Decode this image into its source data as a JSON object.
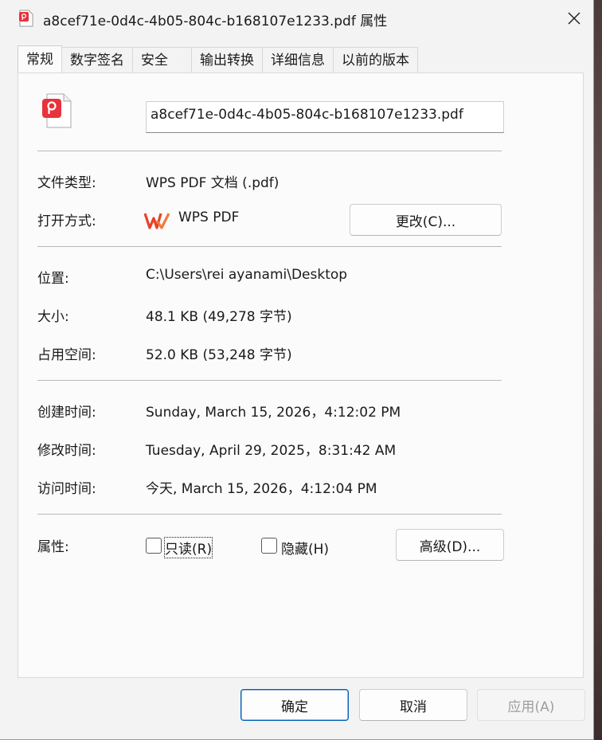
{
  "window": {
    "title": "a8cef71e-0d4c-4b05-804c-b168107e1233.pdf 属性",
    "close_icon": "close-icon"
  },
  "tabs": [
    {
      "label": "常规",
      "active": true
    },
    {
      "label": "数字签名",
      "active": false
    },
    {
      "label": "安全",
      "active": false
    },
    {
      "label": "输出转换",
      "active": false
    },
    {
      "label": "详细信息",
      "active": false
    },
    {
      "label": "以前的版本",
      "active": false
    }
  ],
  "general": {
    "file_name": "a8cef71e-0d4c-4b05-804c-b168107e1233.pdf",
    "file_type_label": "文件类型:",
    "file_type_value": "WPS PDF 文档 (.pdf)",
    "open_with_label": "打开方式:",
    "open_with_app": "WPS PDF",
    "change_button": "更改(C)...",
    "location_label": "位置:",
    "location_value": "C:\\Users\\rei ayanami\\Desktop",
    "size_label": "大小:",
    "size_value": "48.1 KB (49,278 字节)",
    "size_on_disk_label": "占用空间:",
    "size_on_disk_value": "52.0 KB (53,248 字节)",
    "created_label": "创建时间:",
    "created_value": "Sunday, March 15, 2026，4:12:02 PM",
    "modified_label": "修改时间:",
    "modified_value": "Tuesday, April 29, 2025，8:31:42 AM",
    "accessed_label": "访问时间:",
    "accessed_value": "今天, March 15, 2026，4:12:04 PM",
    "attributes_label": "属性:",
    "readonly_label": "只读(R)",
    "readonly_checked": false,
    "hidden_label": "隐藏(H)",
    "hidden_checked": false,
    "advanced_button": "高级(D)..."
  },
  "footer": {
    "ok": "确定",
    "cancel": "取消",
    "apply": "应用(A)"
  },
  "colors": {
    "pdf_red": "#e8323c",
    "wps_red": "#e8402a",
    "primary_border": "#005fb8"
  }
}
